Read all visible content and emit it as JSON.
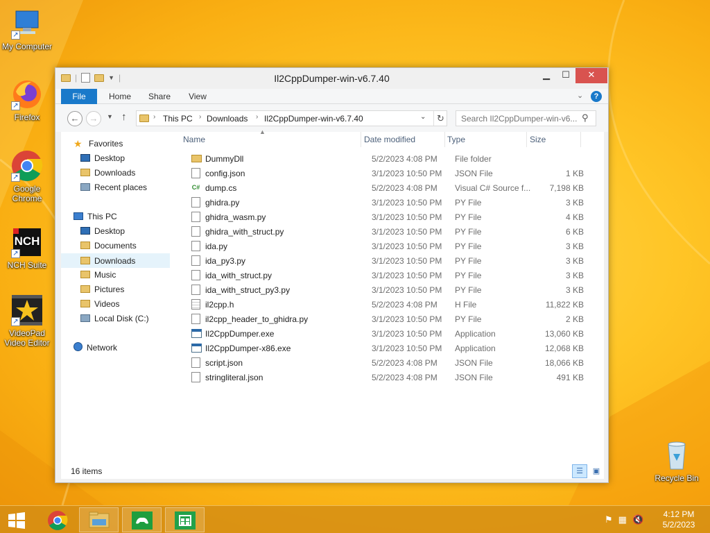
{
  "desktop": {
    "icons": [
      {
        "label": "My Computer"
      },
      {
        "label": "Firefox"
      },
      {
        "label": "Google Chrome"
      },
      {
        "label": "NCH Suite"
      },
      {
        "label": "VideoPad Video Editor"
      },
      {
        "label": "Recycle Bin"
      }
    ]
  },
  "window": {
    "title": "Il2CppDumper-win-v6.7.40",
    "controls": {
      "minimize": "▁",
      "maximize": "☐",
      "close": "✕"
    },
    "ribbon": {
      "file": "File",
      "home": "Home",
      "share": "Share",
      "view": "View",
      "help": "?"
    },
    "address": {
      "crumbs": [
        "This PC",
        "Downloads",
        "Il2CppDumper-win-v6.7.40"
      ]
    },
    "search": {
      "placeholder": "Search Il2CppDumper-win-v6..."
    },
    "nav_pane": {
      "favorites": "Favorites",
      "favorites_items": [
        "Desktop",
        "Downloads",
        "Recent places"
      ],
      "this_pc": "This PC",
      "this_pc_items": [
        "Desktop",
        "Documents",
        "Downloads",
        "Music",
        "Pictures",
        "Videos",
        "Local Disk (C:)"
      ],
      "network": "Network"
    },
    "columns": {
      "name": "Name",
      "date": "Date modified",
      "type": "Type",
      "size": "Size"
    },
    "files": [
      {
        "name": "DummyDll",
        "date": "5/2/2023 4:08 PM",
        "type": "File folder",
        "size": "",
        "icon": "folder"
      },
      {
        "name": "config.json",
        "date": "3/1/2023 10:50 PM",
        "type": "JSON File",
        "size": "1 KB",
        "icon": "doc"
      },
      {
        "name": "dump.cs",
        "date": "5/2/2023 4:08 PM",
        "type": "Visual C# Source f...",
        "size": "7,198 KB",
        "icon": "cs"
      },
      {
        "name": "ghidra.py",
        "date": "3/1/2023 10:50 PM",
        "type": "PY File",
        "size": "3 KB",
        "icon": "doc"
      },
      {
        "name": "ghidra_wasm.py",
        "date": "3/1/2023 10:50 PM",
        "type": "PY File",
        "size": "4 KB",
        "icon": "doc"
      },
      {
        "name": "ghidra_with_struct.py",
        "date": "3/1/2023 10:50 PM",
        "type": "PY File",
        "size": "6 KB",
        "icon": "doc"
      },
      {
        "name": "ida.py",
        "date": "3/1/2023 10:50 PM",
        "type": "PY File",
        "size": "3 KB",
        "icon": "doc"
      },
      {
        "name": "ida_py3.py",
        "date": "3/1/2023 10:50 PM",
        "type": "PY File",
        "size": "3 KB",
        "icon": "doc"
      },
      {
        "name": "ida_with_struct.py",
        "date": "3/1/2023 10:50 PM",
        "type": "PY File",
        "size": "3 KB",
        "icon": "doc"
      },
      {
        "name": "ida_with_struct_py3.py",
        "date": "3/1/2023 10:50 PM",
        "type": "PY File",
        "size": "3 KB",
        "icon": "doc"
      },
      {
        "name": "il2cpp.h",
        "date": "5/2/2023 4:08 PM",
        "type": "H File",
        "size": "11,822 KB",
        "icon": "h"
      },
      {
        "name": "il2cpp_header_to_ghidra.py",
        "date": "3/1/2023 10:50 PM",
        "type": "PY File",
        "size": "2 KB",
        "icon": "doc"
      },
      {
        "name": "Il2CppDumper.exe",
        "date": "3/1/2023 10:50 PM",
        "type": "Application",
        "size": "13,060 KB",
        "icon": "exe"
      },
      {
        "name": "Il2CppDumper-x86.exe",
        "date": "3/1/2023 10:50 PM",
        "type": "Application",
        "size": "12,068 KB",
        "icon": "exe"
      },
      {
        "name": "script.json",
        "date": "5/2/2023 4:08 PM",
        "type": "JSON File",
        "size": "18,066 KB",
        "icon": "doc"
      },
      {
        "name": "stringliteral.json",
        "date": "5/2/2023 4:08 PM",
        "type": "JSON File",
        "size": "491 KB",
        "icon": "doc"
      }
    ],
    "status": {
      "count": "16 items"
    }
  },
  "taskbar": {
    "clock_time": "4:12 PM",
    "clock_date": "5/2/2023"
  },
  "colors": {
    "accent": "#1979ca",
    "selection": "#e5f3fb",
    "close": "#d9534f"
  }
}
